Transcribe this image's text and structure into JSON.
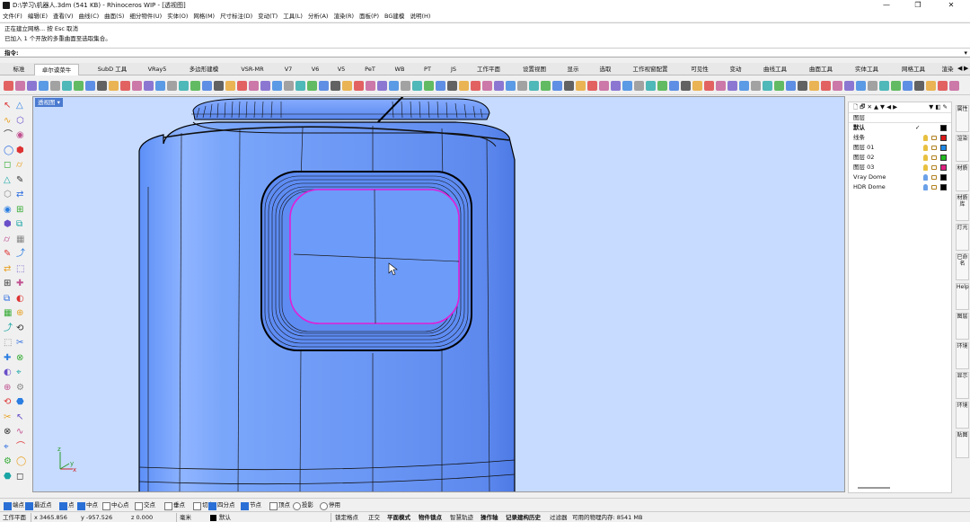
{
  "window": {
    "title": "D:\\学习\\机器人.3dm (541 KB) - Rhinoceros WIP - [透视图]",
    "minimize": "—",
    "maximize": "❐",
    "close": "✕"
  },
  "menu": [
    "文件(F)",
    "编辑(E)",
    "查看(V)",
    "曲线(C)",
    "曲面(S)",
    "细分物件(U)",
    "实体(O)",
    "网格(M)",
    "尺寸标注(D)",
    "变动(T)",
    "工具(L)",
    "分析(A)",
    "渲染(R)",
    "面板(P)",
    "BG建模",
    "说明(H)"
  ],
  "command_history": [
    "正在建立网格... 按 Esc 取消",
    "已加入 1 个开放的多重曲面至选取集合。"
  ],
  "command_prompt": "指令:",
  "tabs": [
    "标准",
    "卓尔谟菜牛",
    "SubD 工具",
    "VRay5",
    "多边形建模",
    "VSR-MR",
    "V7",
    "V6",
    "V5",
    "PeT",
    "WB",
    "PT",
    "JS",
    "工作平面",
    "设置视图",
    "显示",
    "选取",
    "工作视窗配置",
    "可见性",
    "变动",
    "曲线工具",
    "曲面工具",
    "实体工具",
    "网格工具",
    "渲染"
  ],
  "active_tab": "卓尔谟菜牛",
  "viewport_label": "透视图",
  "panel": {
    "header": "图层",
    "default_label": "默认",
    "layers": [
      {
        "name": "线条",
        "color": "#d81818"
      },
      {
        "name": "图层 01",
        "color": "#1e88e5"
      },
      {
        "name": "图层 02",
        "color": "#22bb22"
      },
      {
        "name": "图层 03",
        "color": "#e01f80"
      },
      {
        "name": "Vray Dome",
        "color": "#000000"
      },
      {
        "name": "HDR Dome",
        "color": "#000000"
      }
    ]
  },
  "side_tabs": [
    "属性",
    "渲染",
    "材质",
    "材质库",
    "灯光",
    "已命名",
    "Help",
    "图层",
    "环境",
    "显示",
    "环境",
    "贴图"
  ],
  "osnap": [
    {
      "label": "端点",
      "on": true
    },
    {
      "label": "最近点",
      "on": true
    },
    {
      "label": "点",
      "on": true
    },
    {
      "label": "中点",
      "on": true
    },
    {
      "label": "中心点",
      "on": false
    },
    {
      "label": "交点",
      "on": false
    },
    {
      "label": "垂点",
      "on": false
    },
    {
      "label": "切点",
      "on": false
    },
    {
      "label": "四分点",
      "on": true
    },
    {
      "label": "节点",
      "on": true
    },
    {
      "label": "顶点",
      "on": false
    },
    {
      "label": "投影",
      "on": false,
      "radio": true
    },
    {
      "label": "停用",
      "on": false,
      "radio": true
    }
  ],
  "status": {
    "cplane": "工作平面",
    "x": "x 3465.856",
    "y": "y -957.526",
    "z": "z 0.000",
    "units": "毫米",
    "layer": "默认",
    "items": [
      "锁定格点",
      "正交",
      "平面模式",
      "物件锁点",
      "智慧轨迹",
      "操作轴",
      "记录建构历史",
      "过滤器",
      "可用的物理内存: 8541 MB"
    ]
  },
  "axes": {
    "x": "x",
    "y": "y",
    "z": "z"
  }
}
